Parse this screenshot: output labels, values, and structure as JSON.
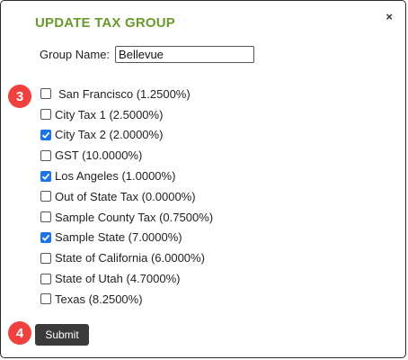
{
  "dialog": {
    "title": "UPDATE TAX GROUP",
    "close_label": "×"
  },
  "group_name": {
    "label": "Group Name:",
    "value": "Bellevue"
  },
  "taxes": [
    {
      "label": "San Francisco (1.2500%)",
      "checked": false
    },
    {
      "label": "City Tax 1 (2.5000%)",
      "checked": false
    },
    {
      "label": "City Tax 2 (2.0000%)",
      "checked": true
    },
    {
      "label": "GST (10.0000%)",
      "checked": false
    },
    {
      "label": "Los Angeles (1.0000%)",
      "checked": true
    },
    {
      "label": "Out of State Tax (0.0000%)",
      "checked": false
    },
    {
      "label": "Sample County Tax (0.7500%)",
      "checked": false
    },
    {
      "label": "Sample State (7.0000%)",
      "checked": true
    },
    {
      "label": "State of California (6.0000%)",
      "checked": false
    },
    {
      "label": "State of Utah (4.7000%)",
      "checked": false
    },
    {
      "label": "Texas (8.2500%)",
      "checked": false
    }
  ],
  "annotations": {
    "step_3": "3",
    "step_4": "4"
  },
  "submit_label": "Submit",
  "colors": {
    "title": "#6a9a2c",
    "checkbox_checked": "#1a73e8",
    "badge": "#f0413e",
    "submit_bg": "#3a3a3a"
  }
}
